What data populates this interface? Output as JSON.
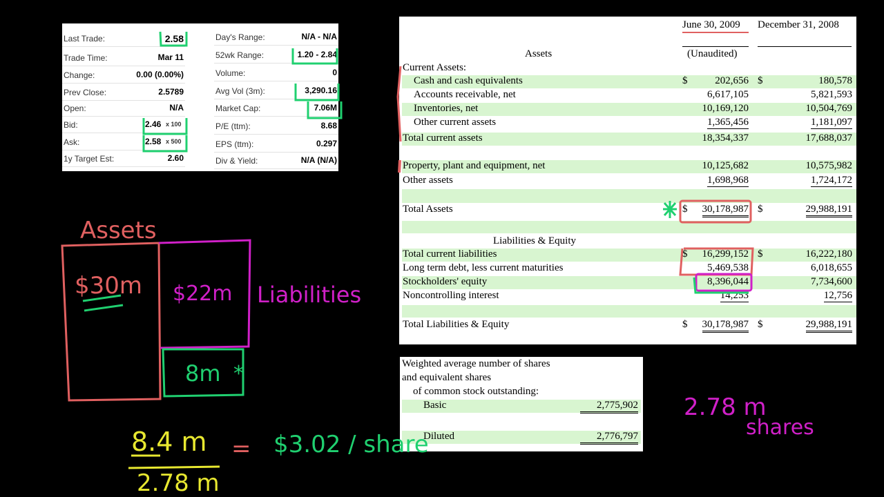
{
  "quote": {
    "left": [
      {
        "label": "Last Trade:",
        "value": "2.58"
      },
      {
        "label": "Trade Time:",
        "value": "Mar 11"
      },
      {
        "label": "Change:",
        "value": "0.00 (0.00%)"
      },
      {
        "label": "Prev Close:",
        "value": "2.5789"
      },
      {
        "label": "Open:",
        "value": "N/A"
      },
      {
        "label": "Bid:",
        "value": "2.46",
        "suffix": "x 100"
      },
      {
        "label": "Ask:",
        "value": "2.58",
        "suffix": "x 500"
      },
      {
        "label": "1y Target Est:",
        "value": "2.60"
      }
    ],
    "right": [
      {
        "label": "Day's Range:",
        "value": "N/A - N/A"
      },
      {
        "label": "52wk Range:",
        "value": "1.20 - 2.84"
      },
      {
        "label": "Volume:",
        "value": "0"
      },
      {
        "label": "Avg Vol (3m):",
        "value": "3,290.16"
      },
      {
        "label": "Market Cap:",
        "value": "7.06M"
      },
      {
        "label": "P/E (ttm):",
        "value": "8.68"
      },
      {
        "label": "EPS (ttm):",
        "value": "0.297"
      },
      {
        "label": "Div & Yield:",
        "value": "N/A (N/A)"
      }
    ]
  },
  "balance_sheet": {
    "col1_header": "June 30, 2009",
    "col2_header": "December 31, 2008",
    "unaudited": "(Unaudited)",
    "assets_title": "Assets",
    "current_assets_label": "Current Assets:",
    "rows": {
      "cash": {
        "label": "Cash and cash equivalents",
        "v1": "202,656",
        "v2": "180,578",
        "d": "$"
      },
      "ar": {
        "label": "Accounts receivable, net",
        "v1": "6,617,105",
        "v2": "5,821,593"
      },
      "inv": {
        "label": "Inventories, net",
        "v1": "10,169,120",
        "v2": "10,504,769"
      },
      "oca": {
        "label": "Other current assets",
        "v1": "1,365,456",
        "v2": "1,181,097"
      },
      "tca": {
        "label": "Total current assets",
        "v1": "18,354,337",
        "v2": "17,688,037"
      },
      "ppe": {
        "label": "Property, plant and equipment, net",
        "v1": "10,125,682",
        "v2": "10,575,982"
      },
      "oa": {
        "label": "Other assets",
        "v1": "1,698,968",
        "v2": "1,724,172"
      },
      "ta": {
        "label": "Total Assets",
        "v1": "30,178,987",
        "v2": "29,988,191",
        "d": "$"
      },
      "tcl": {
        "label": "Total current liabilities",
        "v1": "16,299,152",
        "v2": "16,222,180",
        "d": "$"
      },
      "ltd": {
        "label": "Long term debt, less current maturities",
        "v1": "5,469,538",
        "v2": "6,018,655"
      },
      "se": {
        "label": "Stockholders' equity",
        "v1": "8,396,044",
        "v2": "7,734,600"
      },
      "nci": {
        "label": "Noncontrolling interest",
        "v1": "14,253",
        "v2": "12,756"
      },
      "tle": {
        "label": "Total Liabilities & Equity",
        "v1": "30,178,987",
        "v2": "29,988,191",
        "d": "$"
      }
    },
    "le_title": "Liabilities & Equity"
  },
  "shares": {
    "line1": "Weighted average number of shares",
    "line2": "and equivalent shares",
    "line3": "of common stock outstanding:",
    "basic_label": "Basic",
    "basic_value": "2,775,902",
    "diluted_label": "Diluted",
    "diluted_value": "2,776,797"
  },
  "annotations": {
    "assets": "Assets",
    "thirty": "$30m",
    "twentytwo": "$22m",
    "liabilities": "Liabilities",
    "eight": "8m",
    "numerator": "8.4 m",
    "denominator": "2.78 m",
    "equals": "=",
    "result": "$3.02 / share",
    "shares_count": "2.78 m",
    "shares_word": "shares",
    "star": "*"
  },
  "colors": {
    "red": "#e06060",
    "magenta": "#d020c8",
    "green": "#20d070",
    "yellow": "#e8e830",
    "row_green": "#d8f5d0"
  }
}
